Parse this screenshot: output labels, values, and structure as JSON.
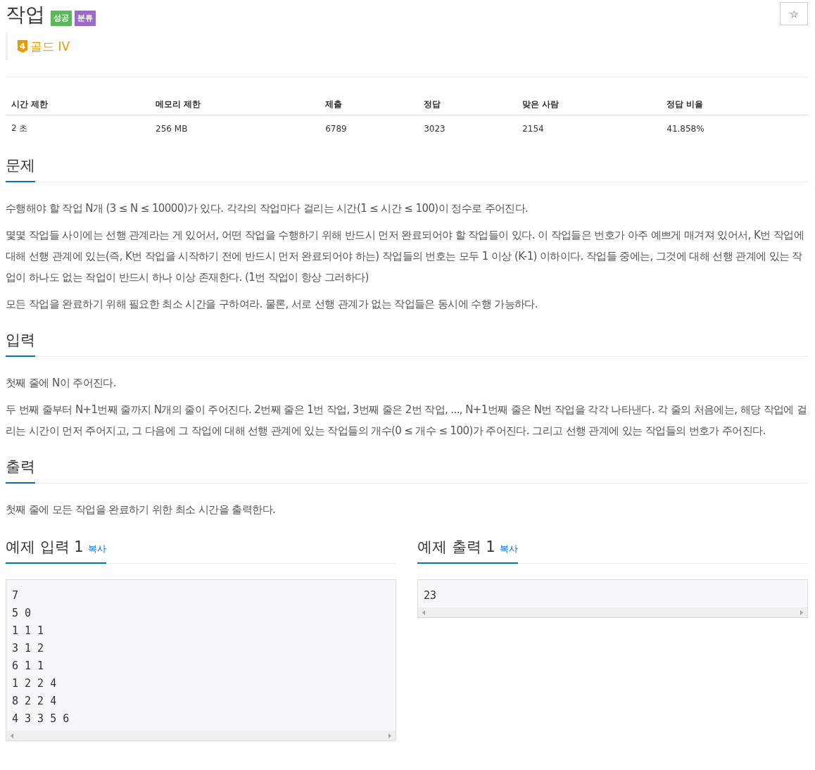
{
  "title": "작업",
  "labels": [
    {
      "text": "성공",
      "color": "#5cb85c"
    },
    {
      "text": "분류",
      "color": "#9b6bcc"
    }
  ],
  "star_button": "☆",
  "tier": {
    "badge": "4",
    "name": "골드 IV"
  },
  "stats": {
    "columns": [
      "시간 제한",
      "메모리 제한",
      "제출",
      "정답",
      "맞은 사람",
      "정답 비율"
    ],
    "row": [
      "2 초",
      "256 MB",
      "6789",
      "3023",
      "2154",
      "41.858%"
    ]
  },
  "sections": [
    {
      "heading": "문제",
      "paragraphs": [
        "수행해야 할 작업 N개 (3 ≤ N ≤ 10000)가 있다. 각각의 작업마다 걸리는 시간(1 ≤ 시간 ≤ 100)이 정수로 주어진다.",
        "몇몇 작업들 사이에는 선행 관계라는 게 있어서, 어떤 작업을 수행하기 위해 반드시 먼저 완료되어야 할 작업들이 있다. 이 작업들은 번호가 아주 예쁘게 매겨져 있어서, K번 작업에 대해 선행 관계에 있는(즉, K번 작업을 시작하기 전에 반드시 먼저 완료되어야 하는) 작업들의 번호는 모두 1 이상 (K-1) 이하이다. 작업들 중에는, 그것에 대해 선행 관계에 있는 작업이 하나도 없는 작업이 반드시 하나 이상 존재한다. (1번 작업이 항상 그러하다)",
        "모든 작업을 완료하기 위해 필요한 최소 시간을 구하여라. 물론, 서로 선행 관계가 없는 작업들은 동시에 수행 가능하다."
      ]
    },
    {
      "heading": "입력",
      "paragraphs": [
        "첫째 줄에 N이 주어진다.",
        "두 번째 줄부터 N+1번째 줄까지 N개의 줄이 주어진다. 2번째 줄은 1번 작업, 3번째 줄은 2번 작업, ..., N+1번째 줄은 N번 작업을 각각 나타낸다. 각 줄의 처음에는, 해당 작업에 걸리는 시간이 먼저 주어지고, 그 다음에 그 작업에 대해 선행 관계에 있는 작업들의 개수(0 ≤ 개수 ≤ 100)가 주어진다. 그리고 선행 관계에 있는 작업들의 번호가 주어진다."
      ]
    },
    {
      "heading": "출력",
      "paragraphs": [
        "첫째 줄에 모든 작업을 완료하기 위한 최소 시간을 출력한다."
      ]
    }
  ],
  "samples": [
    {
      "heading": "예제 입력 1",
      "copy": "복사",
      "lines": [
        "7",
        "5 0",
        "1 1 1",
        "3 1 2",
        "6 1 1",
        "1 2 2 4",
        "8 2 2 4",
        "4 3 3 5 6"
      ]
    },
    {
      "heading": "예제 출력 1",
      "copy": "복사",
      "lines": [
        "23"
      ]
    }
  ]
}
